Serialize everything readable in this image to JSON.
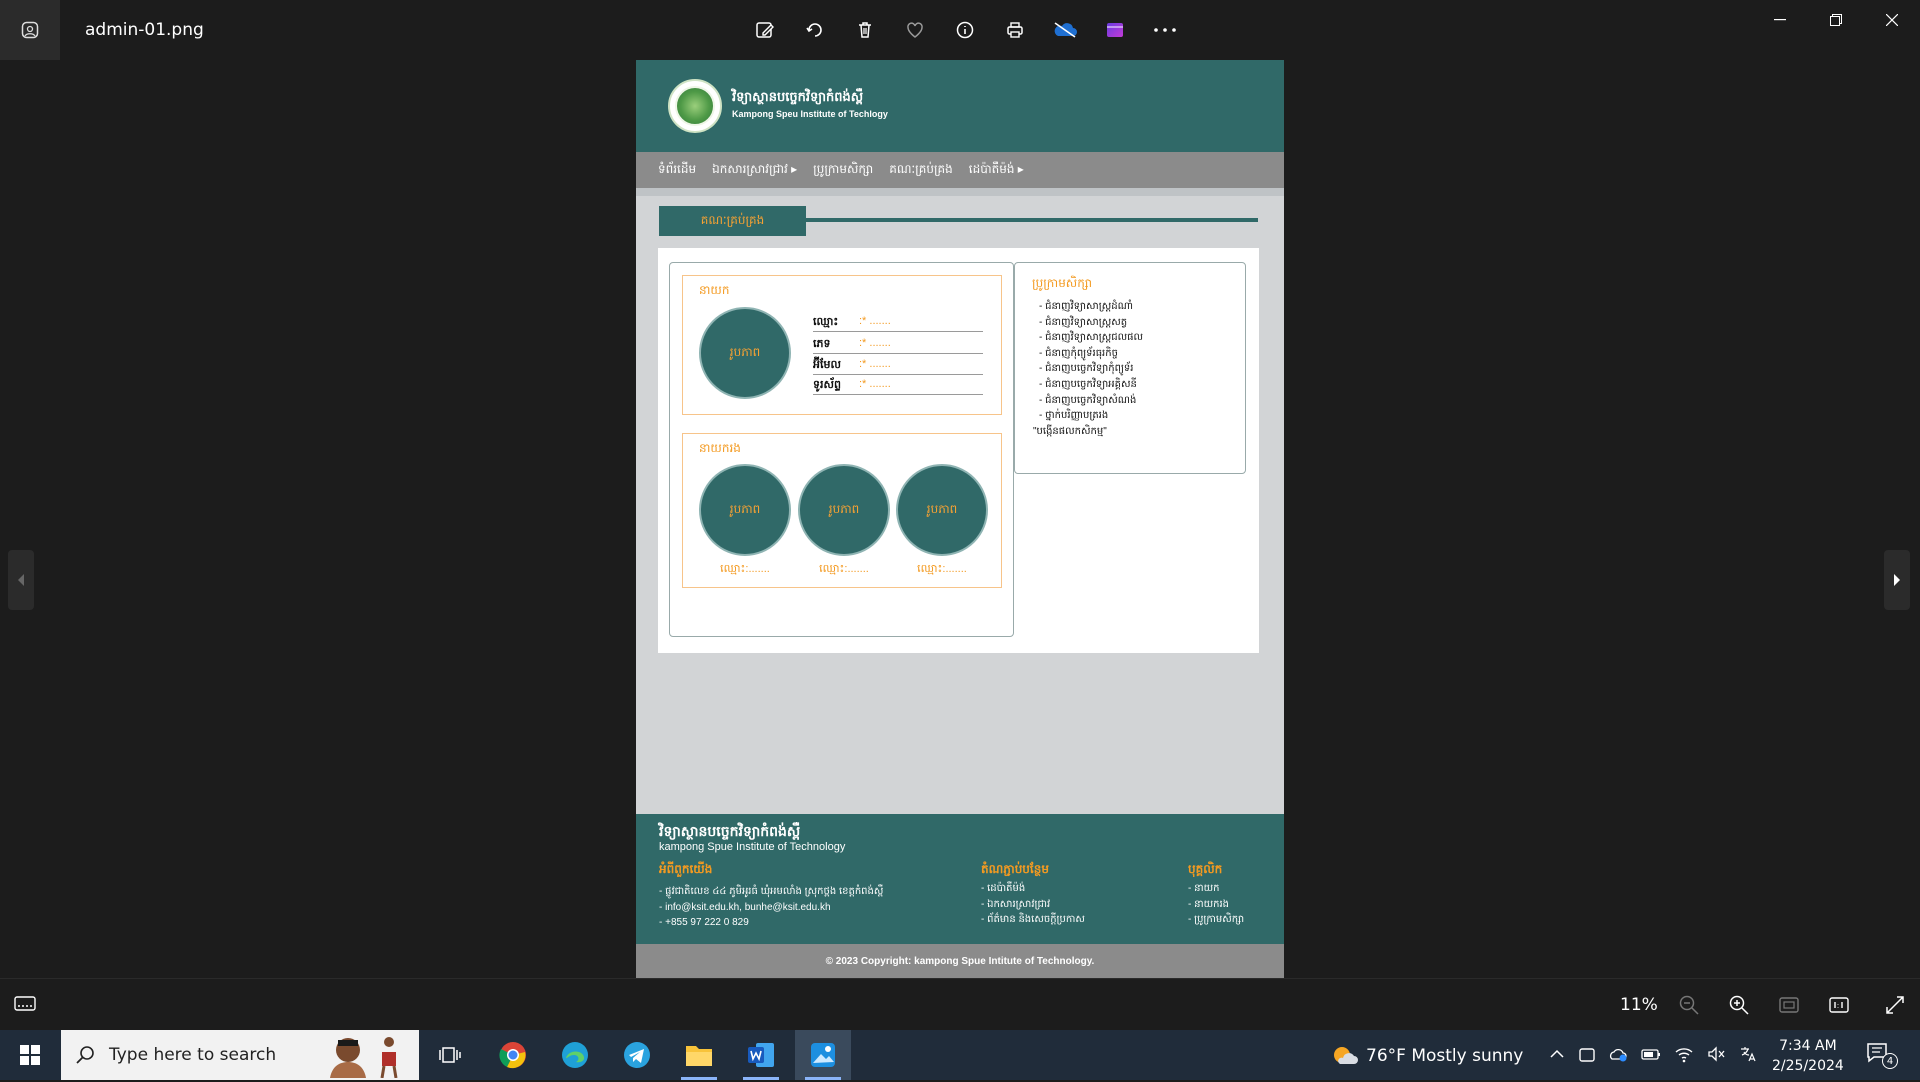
{
  "titlebar": {
    "filename": "admin-01.png",
    "tools": [
      "edit-icon",
      "rotate-icon",
      "delete-icon",
      "favorite-icon",
      "info-icon",
      "print-icon",
      "onedrive-icon",
      "clipchamp-icon",
      "more-icon"
    ]
  },
  "site": {
    "brand_kh": "វិទ្យាស្ថានបច្ចេកវិទ្យាកំពង់ស្ពឺ",
    "brand_en": "Kampong Speu Institute of Techlogy",
    "menu": [
      "ទំព័រដើម",
      "ឯកសារស្រាវជ្រាវ ▸",
      "ប្រូក្រាមសិក្សា",
      "គណៈគ្រប់គ្រង",
      "ដេប៉ាតឺម៉ង់ ▸"
    ],
    "section_title": "គណៈគ្រប់គ្រង",
    "director": {
      "title": "នាយក",
      "photo_label": "រូបភាព",
      "fields": [
        {
          "label": "ឈ្មោះ",
          "value": ":* ......."
        },
        {
          "label": "ភេទ",
          "value": ":* ......."
        },
        {
          "label": "អ៊ីមែល",
          "value": ":* ......."
        },
        {
          "label": "ទូរស័ព្ទ",
          "value": ":* ......."
        }
      ]
    },
    "deputies": {
      "title": "នាយករង",
      "members": [
        {
          "photo_label": "រូបភាព",
          "name": "ឈ្មោះ:......."
        },
        {
          "photo_label": "រូបភាព",
          "name": "ឈ្មោះ:......."
        },
        {
          "photo_label": "រូបភាព",
          "name": "ឈ្មោះ:......."
        }
      ]
    },
    "programs": {
      "title": "ប្រូក្រាមសិក្សា",
      "items": [
        "- ជំនាញវិទ្យាសាស្ត្រដំណាំ",
        "- ជំនាញវិទ្យាសាស្ត្រសត្វ",
        "- ជំនាញវិទ្យាសាស្ត្រជលផល",
        "- ជំនាញកុំព្យូទ័រធុរកិច្ច",
        "- ជំនាញបច្ចេកវិទ្យាកុំព្យូទ័រ",
        "- ជំនាញបច្ចេកវិទ្យាអគ្គិសនី",
        "- ជំនាញបច្ចេកវិទ្យាសំណង់",
        "- ថ្នាក់បរិញ្ញាបត្ររង",
        "\"បង្កើនផលកសិកម្ម\""
      ]
    },
    "footer": {
      "brand_kh": "វិទ្យាស្ថានបច្ចេកវិទ្យាកំពង់ស្ពឺ",
      "brand_en": "kampong Spue Institute of Technology",
      "about_title": "អំពីពួកយើង",
      "about_items": [
        "- ផ្លូវជាតិលេខ ៤៤ ភូមិអូរធំ ឃុំអមលាំង ស្រុកថ្ពង ខេត្តកំពង់ស្ពឺ",
        "- info@ksit.edu.kh, bunhe@ksit.edu.kh",
        "- +855 97 222 0 829"
      ],
      "links_title": "តំណភ្ជាប់បន្ថែម",
      "links_items": [
        "- ដេប៉ាតឺម៉ង់",
        "- ឯកសារស្រាវជ្រាវ",
        "- ព័ត៌មាន និងសេចក្តីប្រកាស"
      ],
      "staff_title": "បុគ្គលិក",
      "staff_items": [
        "- នាយក",
        "- នាយករង",
        "- ប្រូក្រាមសិក្សា"
      ],
      "copyright": "© 2023 Copyright: kampong Spue Intitute of Technology."
    }
  },
  "statusbar": {
    "zoom": "11%"
  },
  "taskbar": {
    "search_placeholder": "Type here to search",
    "weather": "76°F  Mostly sunny",
    "time": "7:34 AM",
    "date": "2/25/2024",
    "notifications": "4"
  },
  "colors": {
    "teal": "#306968",
    "orange": "#f39a21",
    "gray_menu": "#8b8b8b",
    "page_bg": "#d2d4d6"
  }
}
